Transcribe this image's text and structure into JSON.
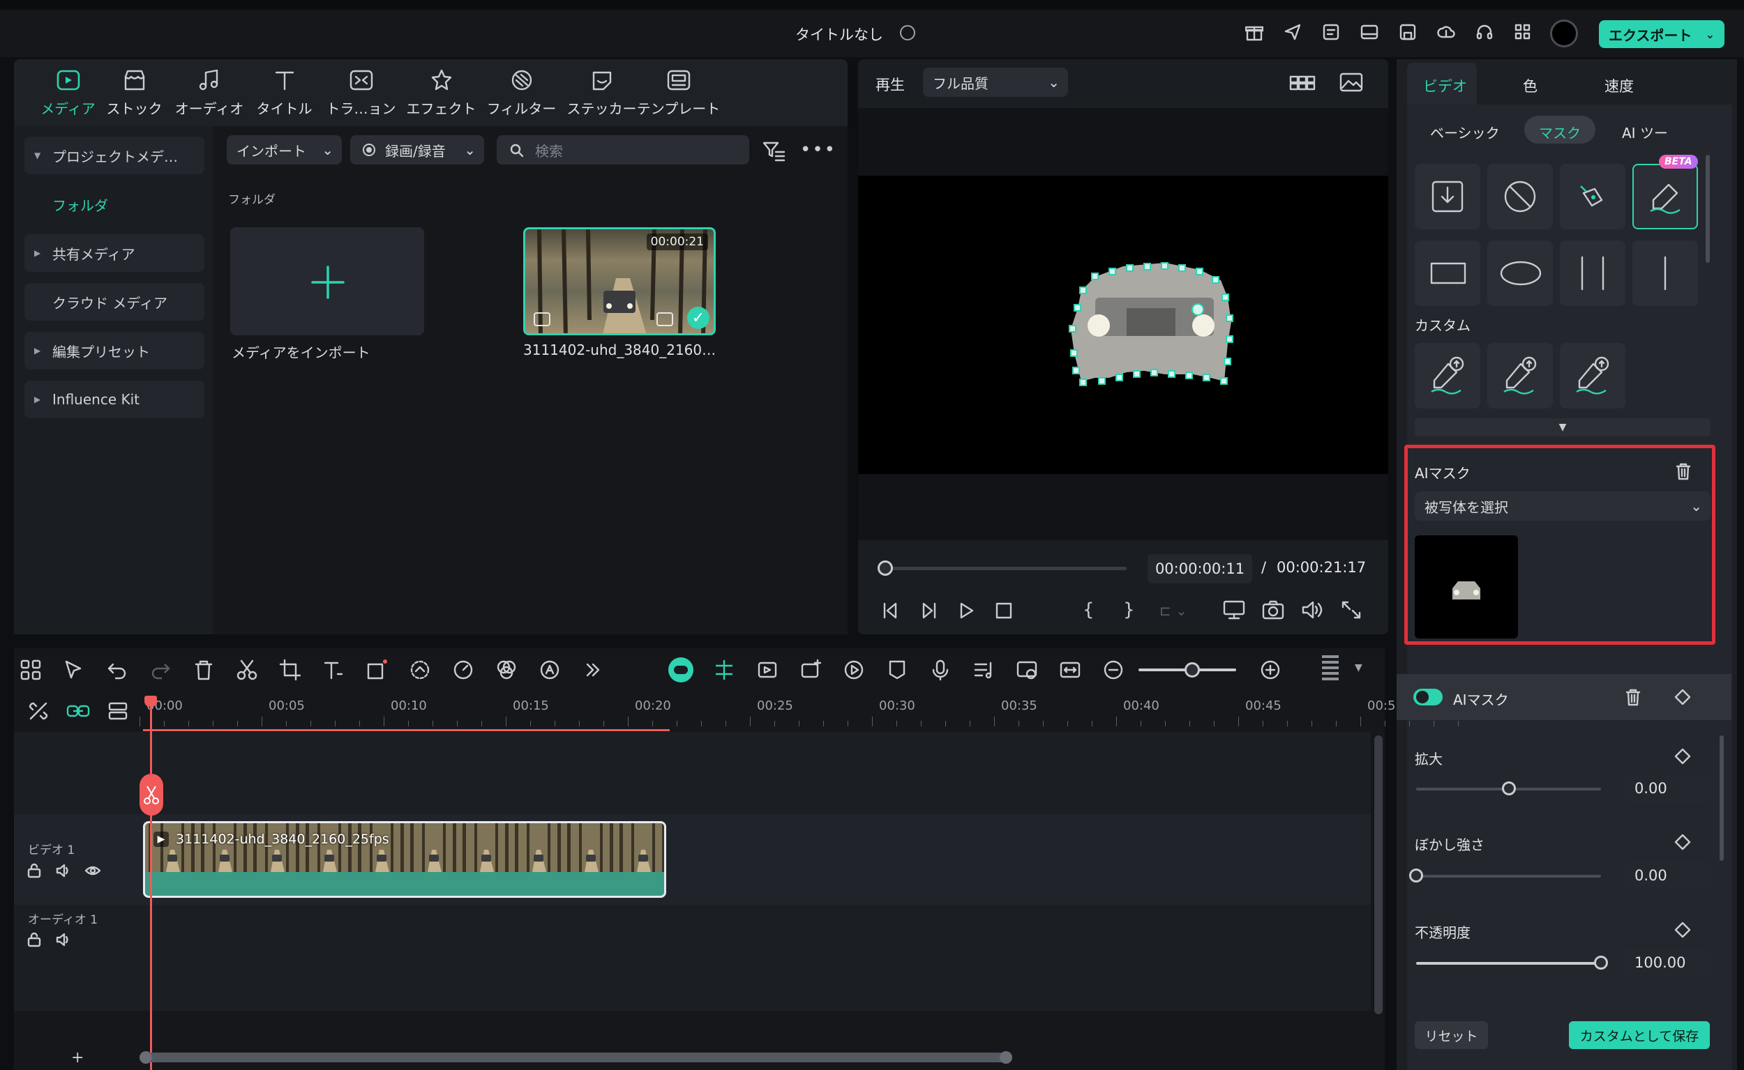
{
  "titlebar": {
    "title": "タイトルなし",
    "export_label": "エクスポート"
  },
  "media_tabs": [
    {
      "label": "メディア",
      "icon": "media-icon",
      "active": true
    },
    {
      "label": "ストック",
      "icon": "stock-icon"
    },
    {
      "label": "オーディオ",
      "icon": "music-note-icon"
    },
    {
      "label": "タイトル",
      "icon": "title-t-icon"
    },
    {
      "label": "トラ…ョン",
      "icon": "transition-icon"
    },
    {
      "label": "エフェクト",
      "icon": "effect-icon"
    },
    {
      "label": "フィルター",
      "icon": "filter-icon"
    },
    {
      "label": "ステッカー",
      "icon": "sticker-icon"
    },
    {
      "label": "テンプレート",
      "icon": "template-icon"
    }
  ],
  "sidebar": {
    "items": [
      {
        "label": "プロジェクトメデ…",
        "expandable": true
      },
      {
        "label": "フォルダ",
        "selected": true
      },
      {
        "label": "共有メディア",
        "expandable": true
      },
      {
        "label": "クラウド メディア"
      },
      {
        "label": "編集プリセット",
        "expandable": true
      },
      {
        "label": "Influence Kit",
        "expandable": true
      }
    ]
  },
  "media_toolbar": {
    "import_label": "インポート",
    "record_label": "録画/録音",
    "search_placeholder": "検索"
  },
  "media_main": {
    "folder_label": "フォルダ",
    "import_tile_label": "メディアをインポート",
    "clip": {
      "name": "3111402-uhd_3840_2160…",
      "duration": "00:00:21"
    }
  },
  "preview": {
    "play_label": "再生",
    "quality": "フル品質",
    "current_time": "00:00:00:11",
    "separator": "/",
    "total_time": "00:00:21:17",
    "progress": 0.01
  },
  "props": {
    "tabs": [
      "ビデオ",
      "色",
      "速度"
    ],
    "subtabs": [
      "ベーシック",
      "マスク",
      "AI ツー"
    ],
    "beta_badge": "BETA",
    "custom_label": "カスタム",
    "ai_mask_section": {
      "title": "AIマスク",
      "select_value": "被写体を選択"
    },
    "ai_mask_row": {
      "label": "AIマスク",
      "enabled": true
    },
    "sliders": [
      {
        "label": "拡大",
        "value": "0.00",
        "level": 0.5
      },
      {
        "label": "ぼかし強さ",
        "value": "0.00",
        "level": 0.0
      },
      {
        "label": "不透明度",
        "value": "100.00",
        "level": 1.0
      }
    ],
    "reset_label": "リセット",
    "save_custom_label": "カスタムとして保存"
  },
  "timeline": {
    "ruler": [
      "00:00",
      "00:05",
      "00:10",
      "00:15",
      "00:20",
      "00:25",
      "00:30",
      "00:35",
      "00:40",
      "00:45",
      "00:5"
    ],
    "tracks": [
      {
        "label": "ビデオ 1"
      },
      {
        "label": "オーディオ 1"
      }
    ],
    "clip_label": "3111402-uhd_3840_2160_25fps",
    "add_label": "+"
  },
  "colors": {
    "accent": "#2ed3b0",
    "highlight_box": "#e0313b",
    "playhead": "#f05a5a"
  }
}
